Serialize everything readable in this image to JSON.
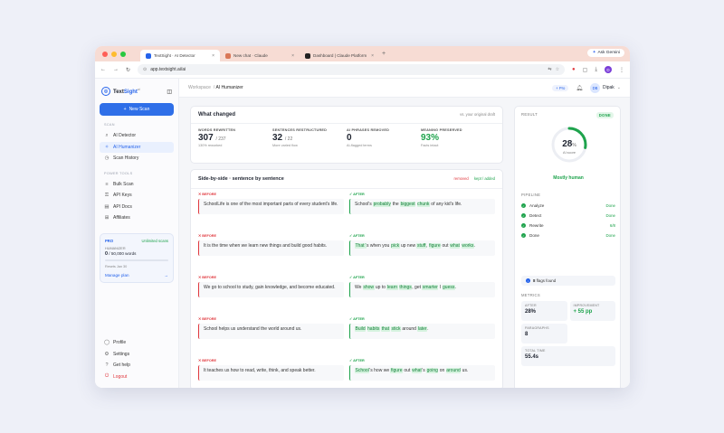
{
  "browser": {
    "tabs": [
      {
        "title": "TextSight · AI Detector",
        "icon_color": "#2563eb",
        "active": true
      },
      {
        "title": "New chat · Claude",
        "icon_color": "#d97757",
        "active": false
      },
      {
        "title": "Dashboard | Claude Platform",
        "icon_color": "#222222",
        "active": false
      }
    ],
    "ask_gemini": "Ask Gemini",
    "url": "app.textsight.ai/ai",
    "profile_initial": "D"
  },
  "sidebar": {
    "brand_prefix": "Text",
    "brand_suffix": "Sight",
    "brand_version": "ai",
    "new_scan": "New Scan",
    "scan_section": "SCAN",
    "scan_items": [
      {
        "label": "AI Detector",
        "icon": "detector-icon"
      },
      {
        "label": "AI Humanizer",
        "icon": "sparkle-icon",
        "active": true
      },
      {
        "label": "Scan History",
        "icon": "history-icon"
      }
    ],
    "power_section": "POWER TOOLS",
    "power_items": [
      {
        "label": "Bulk Scan",
        "icon": "bulk-icon"
      },
      {
        "label": "API Keys",
        "icon": "key-icon"
      },
      {
        "label": "API Docs",
        "icon": "docs-icon"
      },
      {
        "label": "Affiliates",
        "icon": "affiliate-icon"
      }
    ],
    "plan": {
      "name": "PRO",
      "badge": "Unlimited scans",
      "section": "HUMANIZER",
      "used": "0",
      "limit": "/ 50,000 words",
      "progress": 0,
      "reset": "Resets Jan 30",
      "manage": "Manage plan"
    },
    "bottom_items": [
      {
        "label": "Profile",
        "icon": "profile-icon"
      },
      {
        "label": "Settings",
        "icon": "settings-icon"
      },
      {
        "label": "Get help",
        "icon": "help-icon"
      },
      {
        "label": "Logout",
        "icon": "logout-icon"
      }
    ]
  },
  "topbar": {
    "crumb_root": "Workspace",
    "crumb_sep": "/",
    "crumb_current": "AI Humanizer",
    "pro_pill": "+ Pro",
    "avatar": "DB",
    "user": "Dipak"
  },
  "what_changed": {
    "title": "What changed",
    "vs": "vs. your original draft",
    "stats": [
      {
        "label": "WORDS REWRITTEN",
        "value": "307",
        "total": "/ 237",
        "sub": "130% reworked",
        "green": false
      },
      {
        "label": "SENTENCES RESTRUCTURED",
        "value": "32",
        "total": "/ 22",
        "sub": "More varied flow",
        "green": false
      },
      {
        "label": "AI PHRASES REMOVED",
        "value": "0",
        "total": "",
        "sub": "AI-flagged terms",
        "green": false
      },
      {
        "label": "MEANING PRESERVED",
        "value": "93%",
        "total": "",
        "sub": "Facts intact",
        "green": true
      }
    ]
  },
  "side_by_side": {
    "title": "Side-by-side · sentence by sentence",
    "removed": "removed",
    "kept": "kept / added",
    "before_label": "BEFORE",
    "after_label": "AFTER",
    "rows": [
      {
        "before": "SchoolLife is one of the most important parts of every student's life.",
        "after": [
          [
            "School",
            false
          ],
          [
            "'s ",
            false
          ],
          [
            "probably",
            true
          ],
          [
            " the ",
            false
          ],
          [
            "biggest",
            true
          ],
          [
            " ",
            false
          ],
          [
            "chunk",
            true
          ],
          [
            " of any kid",
            false
          ],
          [
            "'",
            false
          ],
          [
            "s life.",
            false
          ]
        ]
      },
      {
        "before": "It is the time when we learn new things and build good habits.",
        "after": [
          [
            "That",
            true
          ],
          [
            "'",
            true
          ],
          [
            "s when you ",
            false
          ],
          [
            "pick",
            true
          ],
          [
            " up new ",
            false
          ],
          [
            "stuff",
            true
          ],
          [
            ", ",
            false
          ],
          [
            "figure",
            true
          ],
          [
            " out ",
            false
          ],
          [
            "what",
            true
          ],
          [
            " ",
            false
          ],
          [
            "works",
            true
          ],
          [
            ".",
            false
          ]
        ]
      },
      {
        "before": "We go to school to study, gain knowledge, and become educated.",
        "after": [
          [
            "We ",
            false
          ],
          [
            "show",
            true
          ],
          [
            " up to ",
            false
          ],
          [
            "learn",
            true
          ],
          [
            " ",
            false
          ],
          [
            "things",
            true
          ],
          [
            ", get ",
            false
          ],
          [
            "smarter",
            true
          ],
          [
            " I ",
            false
          ],
          [
            "guess",
            true
          ],
          [
            ".",
            false
          ]
        ]
      },
      {
        "before": "School helps us understand the world around us.",
        "after": [
          [
            "Build",
            true
          ],
          [
            " ",
            false
          ],
          [
            "habits",
            true
          ],
          [
            " ",
            false
          ],
          [
            "that",
            true
          ],
          [
            " ",
            false
          ],
          [
            "stick",
            true
          ],
          [
            " around ",
            false
          ],
          [
            "later",
            true
          ],
          [
            ".",
            false
          ]
        ]
      },
      {
        "before": "It teaches us how to read, write, think, and speak better.",
        "after": [
          [
            "School",
            true
          ],
          [
            "'s how we ",
            false
          ],
          [
            "figure",
            true
          ],
          [
            " out ",
            false
          ],
          [
            "what",
            true
          ],
          [
            "'s ",
            false
          ],
          [
            "going",
            true
          ],
          [
            " on ",
            false
          ],
          [
            "around",
            true
          ],
          [
            " us.",
            false
          ]
        ]
      }
    ]
  },
  "result": {
    "title": "RESULT",
    "status": "DONE",
    "score": "28",
    "score_unit": "%",
    "score_fraction": 0.28,
    "score_label": "AI score",
    "verdict": "Mostly human",
    "pipeline_title": "PIPELINE",
    "pipeline": [
      {
        "label": "Analyze",
        "status": "Done"
      },
      {
        "label": "Detect",
        "status": "Done"
      },
      {
        "label": "Rewrite",
        "status": "6/8"
      },
      {
        "label": "Done",
        "status": "Done"
      }
    ],
    "flags_count": "8",
    "flags_text": "flags found",
    "metrics_title": "METRICS",
    "metrics": [
      {
        "label": "AFTER",
        "value": "28%",
        "green": false,
        "full": false
      },
      {
        "label": "IMPROVEMENT",
        "value": "+ 55 pp",
        "green": true,
        "full": false
      },
      {
        "label": "PARAGRAPHS",
        "value": "8",
        "green": false,
        "full": false
      },
      {
        "label": "TOTAL TIME",
        "value": "55.4s",
        "green": false,
        "full": true
      }
    ],
    "colors": {
      "accent": "#2563eb",
      "green": "#1ea34c",
      "red": "#e0383e"
    }
  }
}
